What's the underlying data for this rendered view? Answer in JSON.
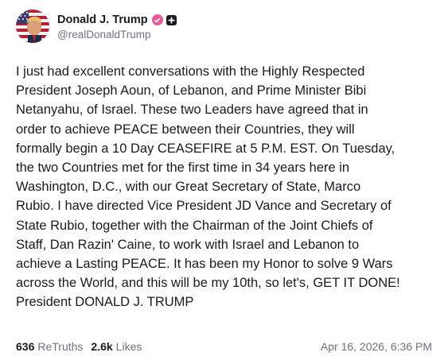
{
  "post": {
    "author": {
      "display_name": "Donald J. Trump",
      "handle": "@realDonaldTrump",
      "avatar_icon": "avatar-portrait-flag",
      "verified_icon": "verified-badge-icon",
      "verified_color": "#e75a9c",
      "plus_icon": "plus-square-icon"
    },
    "body_lines": [
      "I just had excellent conversations with the Highly Respected",
      "President Joseph Aoun, of Lebanon, and Prime Minister Bibi",
      "Netanyahu, of Israel. These two Leaders have agreed that in",
      "order to achieve PEACE between their Countries, they will",
      "formally begin a 10 Day CEASEFIRE at 5 P.M. EST. On Tuesday,",
      "the two Countries met for the first time in 34 years here in",
      "Washington, D.C., with our Great Secretary of State, Marco",
      "Rubio. I have directed Vice President JD Vance and Secretary of",
      "State Rubio, together with the Chairman of the Joint Chiefs of",
      "Staff, Dan Razin' Caine, to work with Israel and Lebanon to",
      "achieve a Lasting PEACE. It has been my Honor to solve 9 Wars",
      "across the World, and this will be my 10th, so let's, GET IT DONE!",
      "President DONALD J. TRUMP"
    ],
    "stats": {
      "retruths_count": "636",
      "retruths_label": "ReTruths",
      "likes_count": "2.6k",
      "likes_label": "Likes"
    },
    "timestamp": "Apr 16, 2026, 6:36 PM"
  }
}
